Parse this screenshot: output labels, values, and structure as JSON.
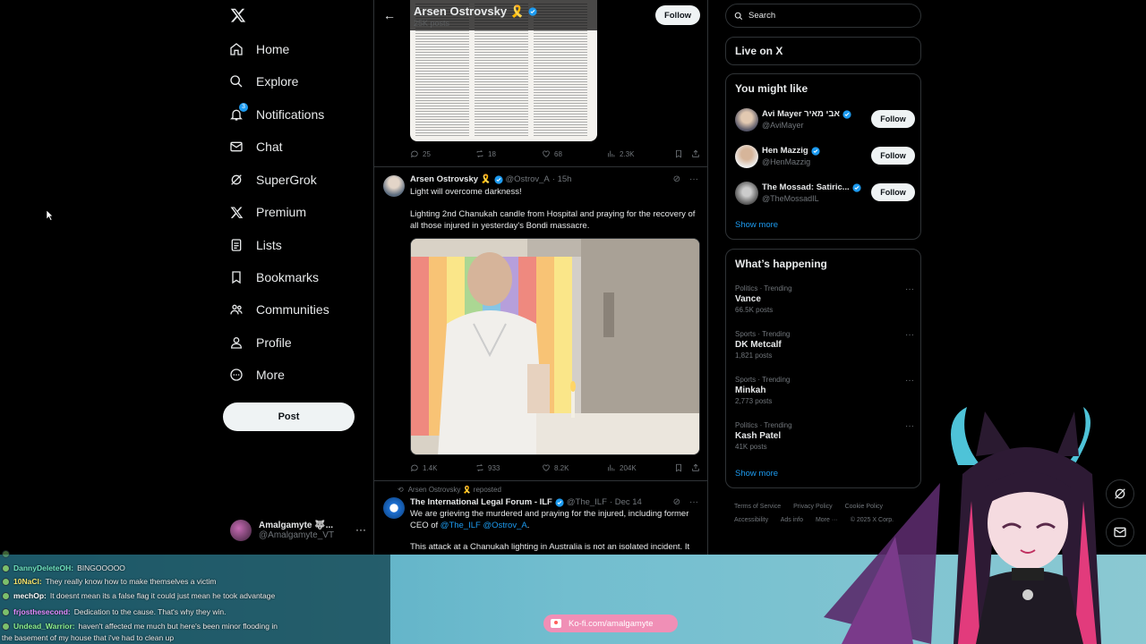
{
  "nav": {
    "items": [
      {
        "label": "Home",
        "icon": "home-icon"
      },
      {
        "label": "Explore",
        "icon": "search-icon"
      },
      {
        "label": "Notifications",
        "icon": "bell-icon",
        "badge": "3"
      },
      {
        "label": "Chat",
        "icon": "mail-icon"
      },
      {
        "label": "SuperGrok",
        "icon": "grok-icon"
      },
      {
        "label": "Premium",
        "icon": "x-logo-icon"
      },
      {
        "label": "Lists",
        "icon": "list-icon"
      },
      {
        "label": "Bookmarks",
        "icon": "bookmark-icon"
      },
      {
        "label": "Communities",
        "icon": "people-icon"
      },
      {
        "label": "Profile",
        "icon": "person-icon"
      },
      {
        "label": "More",
        "icon": "more-circle-icon"
      }
    ],
    "post_label": "Post",
    "account": {
      "name": "Amalgamyte 🐺...",
      "handle": "@Amalgamyte_VT"
    }
  },
  "profile_header": {
    "name": "Arsen Ostrovsky 🎗️",
    "subtitle": "25K posts",
    "follow_label": "Follow"
  },
  "tweet1": {
    "replies": "25",
    "reposts": "18",
    "likes": "68",
    "views": "2.3K"
  },
  "tweet2": {
    "name": "Arsen Ostrovsky 🎗️",
    "handle": "@Ostrov_A",
    "time": "· 15h",
    "line1": "Light will overcome darkness!",
    "line2": "Lighting 2nd Chanukah candle from Hospital and praying for the recovery of all those injured in yesterday's Bondi massacre.",
    "replies": "1.4K",
    "reposts": "933",
    "likes": "8.2K",
    "views": "204K"
  },
  "tweet3": {
    "repost_by": "Arsen Ostrovsky 🎗️ reposted",
    "name": "The International Legal Forum - ILF",
    "handle": "@The_ILF",
    "time": "· Dec 14",
    "text_a": "We are grieving the murdered and praying for the injured, including former CEO of",
    "link1": "@The_ILF",
    "link2": "@Ostrov_A",
    "text_b": ".",
    "text_c": "This attack at a Chanukah lighting in Australia is not an isolated incident. It"
  },
  "right": {
    "search_placeholder": "Search",
    "live_title": "Live on X",
    "wtf_title": "You might like",
    "wtf": [
      {
        "name": "Avi Mayer אבי מאיר",
        "handle": "@AviMayer",
        "follow": "Follow"
      },
      {
        "name": "Hen Mazzig",
        "handle": "@HenMazzig",
        "follow": "Follow"
      },
      {
        "name": "The Mossad: Satiric...",
        "handle": "@TheMossadIL",
        "follow": "Follow"
      }
    ],
    "show_more": "Show more",
    "trending_title": "What’s happening",
    "trends": [
      {
        "cat": "Politics · Trending",
        "name": "Vance",
        "count": "66.5K posts"
      },
      {
        "cat": "Sports · Trending",
        "name": "DK Metcalf",
        "count": "1,821 posts"
      },
      {
        "cat": "Sports · Trending",
        "name": "Minkah",
        "count": "2,773 posts"
      },
      {
        "cat": "Politics · Trending",
        "name": "Kash Patel",
        "count": "41K posts"
      }
    ],
    "show_more_2": "Show more",
    "footer": [
      "Terms of Service",
      "Privacy Policy",
      "Cookie Policy",
      "Accessibility",
      "Ads info",
      "More ···",
      "© 2025 X Corp."
    ]
  },
  "chat": [
    {
      "user": "DannyDeleteOH:",
      "msg": "BINGOOOOO",
      "color": "#6fe3c0"
    },
    {
      "user": "10NaCl:",
      "msg": "They really know how to make themselves a victim",
      "color": "#f6e26b"
    },
    {
      "user": "mechOp:",
      "msg": "It doesnt mean its a false flag it could just mean he took advantage",
      "color": "#ffffff"
    },
    {
      "user": "frjosthesecond:",
      "msg": "Dedication to the cause. That's why they win.",
      "color": "#e38bff"
    },
    {
      "user": "Undead_Warrior:",
      "msg": "haven't affected me much but here's been minor flooding in",
      "color": "#8ef08e"
    },
    {
      "user": "",
      "msg": "the basement of my house that i've had to clean up",
      "color": "#ffffff"
    }
  ],
  "kofi": {
    "label": "Ko-fi.com/amalgamyte"
  },
  "colors": {
    "accent": "#1d9bf0",
    "background": "#000000",
    "border": "#2f3336",
    "muted": "#71767b"
  }
}
